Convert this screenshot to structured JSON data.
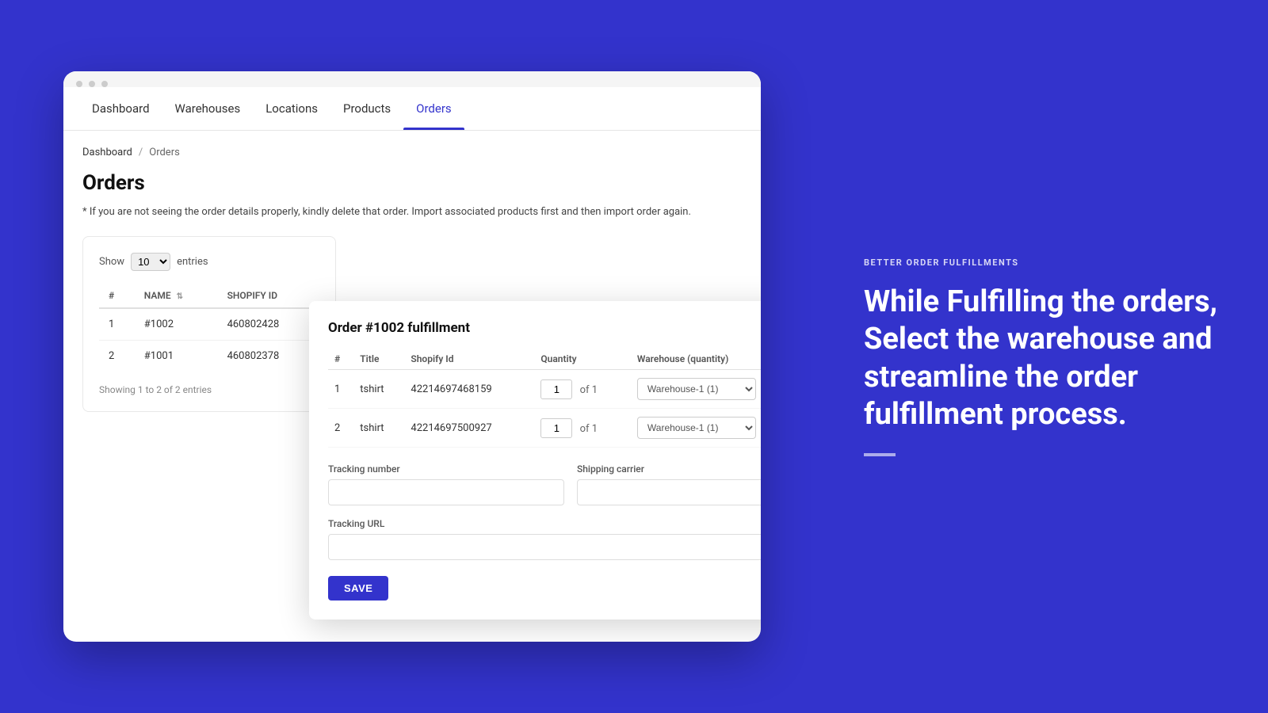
{
  "nav": {
    "items": [
      {
        "label": "Dashboard",
        "active": false
      },
      {
        "label": "Warehouses",
        "active": false
      },
      {
        "label": "Locations",
        "active": false
      },
      {
        "label": "Products",
        "active": false
      },
      {
        "label": "Orders",
        "active": true
      }
    ]
  },
  "breadcrumb": {
    "home": "Dashboard",
    "separator": "/",
    "current": "Orders"
  },
  "page": {
    "title": "Orders",
    "info_text": "* If you are not seeing the order details properly, kindly delete that order. Import associated products first and then import order again."
  },
  "table": {
    "show_label": "Show",
    "entries_value": "10",
    "entries_label": "entries",
    "columns": [
      "#",
      "NAME",
      "SHOPIFY ID"
    ],
    "rows": [
      {
        "num": "1",
        "name": "#1002",
        "shopify_id": "460802428"
      },
      {
        "num": "2",
        "name": "#1001",
        "shopify_id": "460802378"
      }
    ],
    "showing_text": "Showing 1 to 2 of 2 entries"
  },
  "fulfillment": {
    "title": "Order #1002 fulfillment",
    "columns": [
      "#",
      "Title",
      "Shopify Id",
      "Quantity",
      "Warehouse (quantity)"
    ],
    "rows": [
      {
        "num": "1",
        "title": "tshirt",
        "shopify_id": "42214697468159",
        "qty_value": "1",
        "qty_of": "of 1",
        "warehouse": "Warehouse-1 (1)"
      },
      {
        "num": "2",
        "title": "tshirt",
        "shopify_id": "42214697500927",
        "qty_value": "1",
        "qty_of": "of 1",
        "warehouse": "Warehouse-1 (1)"
      }
    ],
    "tracking_number_label": "Tracking number",
    "tracking_number_placeholder": "",
    "shipping_carrier_label": "Shipping carrier",
    "shipping_carrier_placeholder": "",
    "tracking_url_label": "Tracking URL",
    "tracking_url_placeholder": "",
    "save_button": "SAVE"
  },
  "promo": {
    "label": "BETTER ORDER FULFILLMENTS",
    "heading": "While Fulfilling the orders, Select the warehouse and streamline the order fulfillment process."
  }
}
